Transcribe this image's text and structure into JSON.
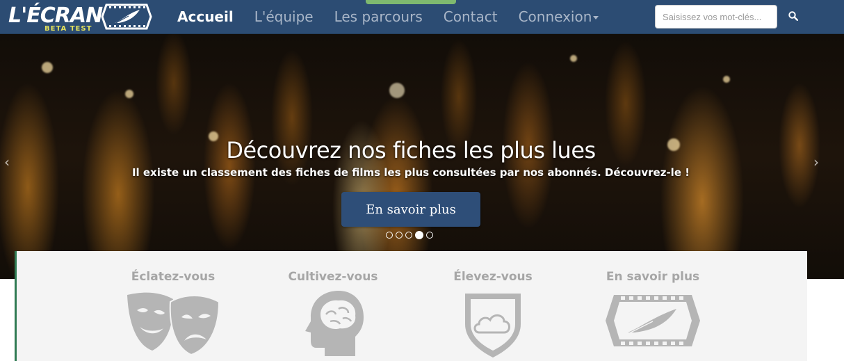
{
  "brand": {
    "name": "L'ÉCRAN",
    "tag": "BETA TEST",
    "logo_icon": "film-feather-logo"
  },
  "nav": {
    "items": [
      {
        "label": "Accueil",
        "active": true
      },
      {
        "label": "L'équipe"
      },
      {
        "label": "Les parcours"
      },
      {
        "label": "Contact"
      },
      {
        "label": "Connexion",
        "dropdown": true
      }
    ]
  },
  "search": {
    "placeholder": "Saisissez vos mot-clés...",
    "button_icon": "search-icon"
  },
  "carousel": {
    "title": "Découvrez nos fiches les plus lues",
    "subtitle": "Il existe un classement des fiches de films les plus consultées par nos abonnés. Découvrez-le !",
    "button_label": "En savoir plus",
    "prev_icon": "‹",
    "next_icon": "›",
    "slides_count": 5,
    "active_slide": 4
  },
  "features": [
    {
      "title": "Éclatez-vous",
      "icon": "theater-masks-icon"
    },
    {
      "title": "Cultivez-vous",
      "icon": "brain-head-icon"
    },
    {
      "title": "Élevez-vous",
      "icon": "cloud-shield-icon"
    },
    {
      "title": "En savoir plus",
      "icon": "film-feather-icon"
    }
  ],
  "colors": {
    "navbar": "#2c4c73",
    "nav_highlight": "#7fb96f",
    "button": "#2e4e78",
    "panel_accent": "#2f7a53",
    "feature_grey": "#a6a6a6"
  }
}
